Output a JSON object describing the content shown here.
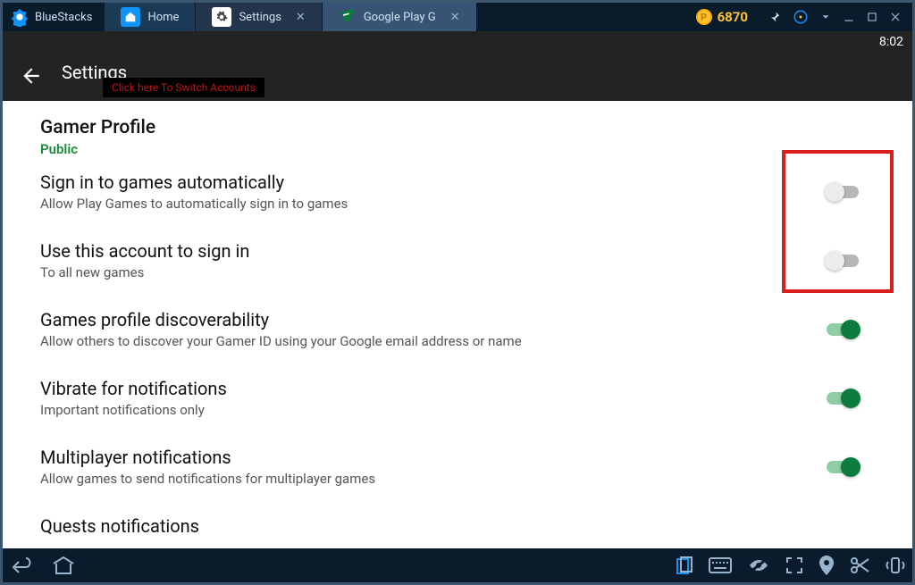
{
  "app": {
    "brand": "BlueStacks"
  },
  "tabs": {
    "home": "Home",
    "settings": "Settings",
    "gplay": "Google Play G"
  },
  "coins": "6870",
  "status": {
    "clock": "8:02"
  },
  "actionbar": {
    "title": "Settings",
    "switch_hint": "Click here To Switch Accounts"
  },
  "profile": {
    "heading": "Gamer Profile",
    "visibility": "Public"
  },
  "settings": {
    "signin_auto": {
      "title": "Sign in to games automatically",
      "desc": "Allow Play Games to automatically sign in to games"
    },
    "use_account": {
      "title": "Use this account to sign in",
      "desc": "To all new games"
    },
    "discoverability": {
      "title": "Games profile discoverability",
      "desc": "Allow others to discover your Gamer ID using your Google email address or name"
    },
    "vibrate": {
      "title": "Vibrate for notifications",
      "desc": "Important notifications only"
    },
    "multiplayer": {
      "title": "Multiplayer notifications",
      "desc": "Allow games to send notifications for multiplayer games"
    },
    "quests": {
      "title": "Quests notifications"
    }
  }
}
